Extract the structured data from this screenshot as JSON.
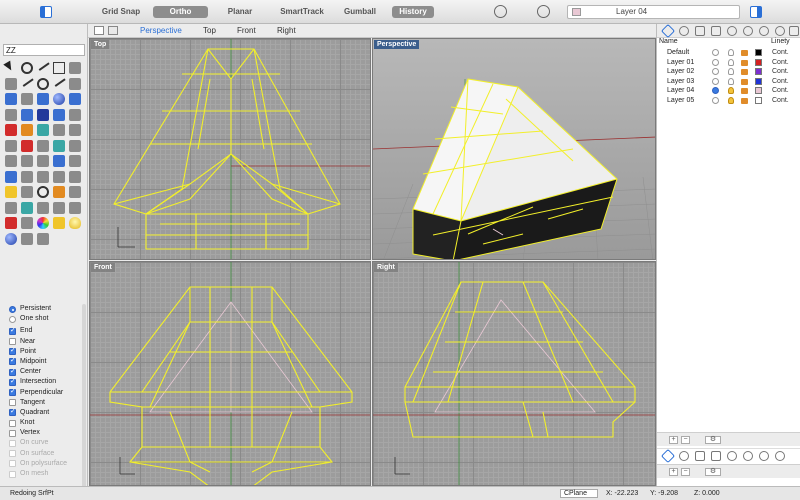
{
  "toolbar": {
    "grid_snap": "Grid Snap",
    "ortho": "Ortho",
    "planar": "Planar",
    "smarttrack": "SmartTrack",
    "gumball": "Gumball",
    "history": "History",
    "current_layer": "Layer 04",
    "icons": [
      "sidebar-toggle-icon",
      "record-history-icon",
      "target-icon"
    ]
  },
  "command": {
    "value": "ZZ"
  },
  "viewport_tabs": [
    "Perspective",
    "Top",
    "Front",
    "Right"
  ],
  "viewports": {
    "top": "Top",
    "perspective": "Perspective",
    "front": "Front",
    "right": "Right"
  },
  "osnap": {
    "modes": [
      {
        "label": "Persistent",
        "type": "radio",
        "checked": true
      },
      {
        "label": "One shot",
        "type": "radio",
        "checked": false
      }
    ],
    "items": [
      {
        "label": "End",
        "checked": true,
        "enabled": true
      },
      {
        "label": "Near",
        "checked": false,
        "enabled": true
      },
      {
        "label": "Point",
        "checked": true,
        "enabled": true
      },
      {
        "label": "Midpoint",
        "checked": true,
        "enabled": true
      },
      {
        "label": "Center",
        "checked": true,
        "enabled": true
      },
      {
        "label": "Intersection",
        "checked": true,
        "enabled": true
      },
      {
        "label": "Perpendicular",
        "checked": true,
        "enabled": true
      },
      {
        "label": "Tangent",
        "checked": false,
        "enabled": true
      },
      {
        "label": "Quadrant",
        "checked": true,
        "enabled": true
      },
      {
        "label": "Knot",
        "checked": false,
        "enabled": true
      },
      {
        "label": "Vertex",
        "checked": false,
        "enabled": true
      },
      {
        "label": "On curve",
        "checked": false,
        "enabled": false
      },
      {
        "label": "On surface",
        "checked": false,
        "enabled": false
      },
      {
        "label": "On polysurface",
        "checked": false,
        "enabled": false
      },
      {
        "label": "On mesh",
        "checked": false,
        "enabled": false
      }
    ]
  },
  "layers": {
    "header_name": "Name",
    "header_linetype": "Linety",
    "rows": [
      {
        "name": "Default",
        "current": false,
        "visible": false,
        "color": "#000000",
        "linetype": "Cont."
      },
      {
        "name": "Layer 01",
        "current": false,
        "visible": false,
        "color": "#d42020",
        "linetype": "Cont."
      },
      {
        "name": "Layer 02",
        "current": false,
        "visible": false,
        "color": "#7b2fd0",
        "linetype": "Cont."
      },
      {
        "name": "Layer 03",
        "current": false,
        "visible": false,
        "color": "#1f33d6",
        "linetype": "Cont."
      },
      {
        "name": "Layer 04",
        "current": true,
        "visible": true,
        "color": "#e9c8d4",
        "linetype": "Cont."
      },
      {
        "name": "Layer 05",
        "current": false,
        "visible": true,
        "color": "#ffffff",
        "linetype": "Cont."
      }
    ]
  },
  "status": {
    "message": "Redoing SrfPt",
    "cplane": "CPlane",
    "x": "X: -22.223",
    "y": "Y: -9.208",
    "z": "Z: 0.000"
  },
  "colors": {
    "wire": "#f2ef2a",
    "accent": "#2a6fd6",
    "pink_curve": "#e9c8d4"
  }
}
